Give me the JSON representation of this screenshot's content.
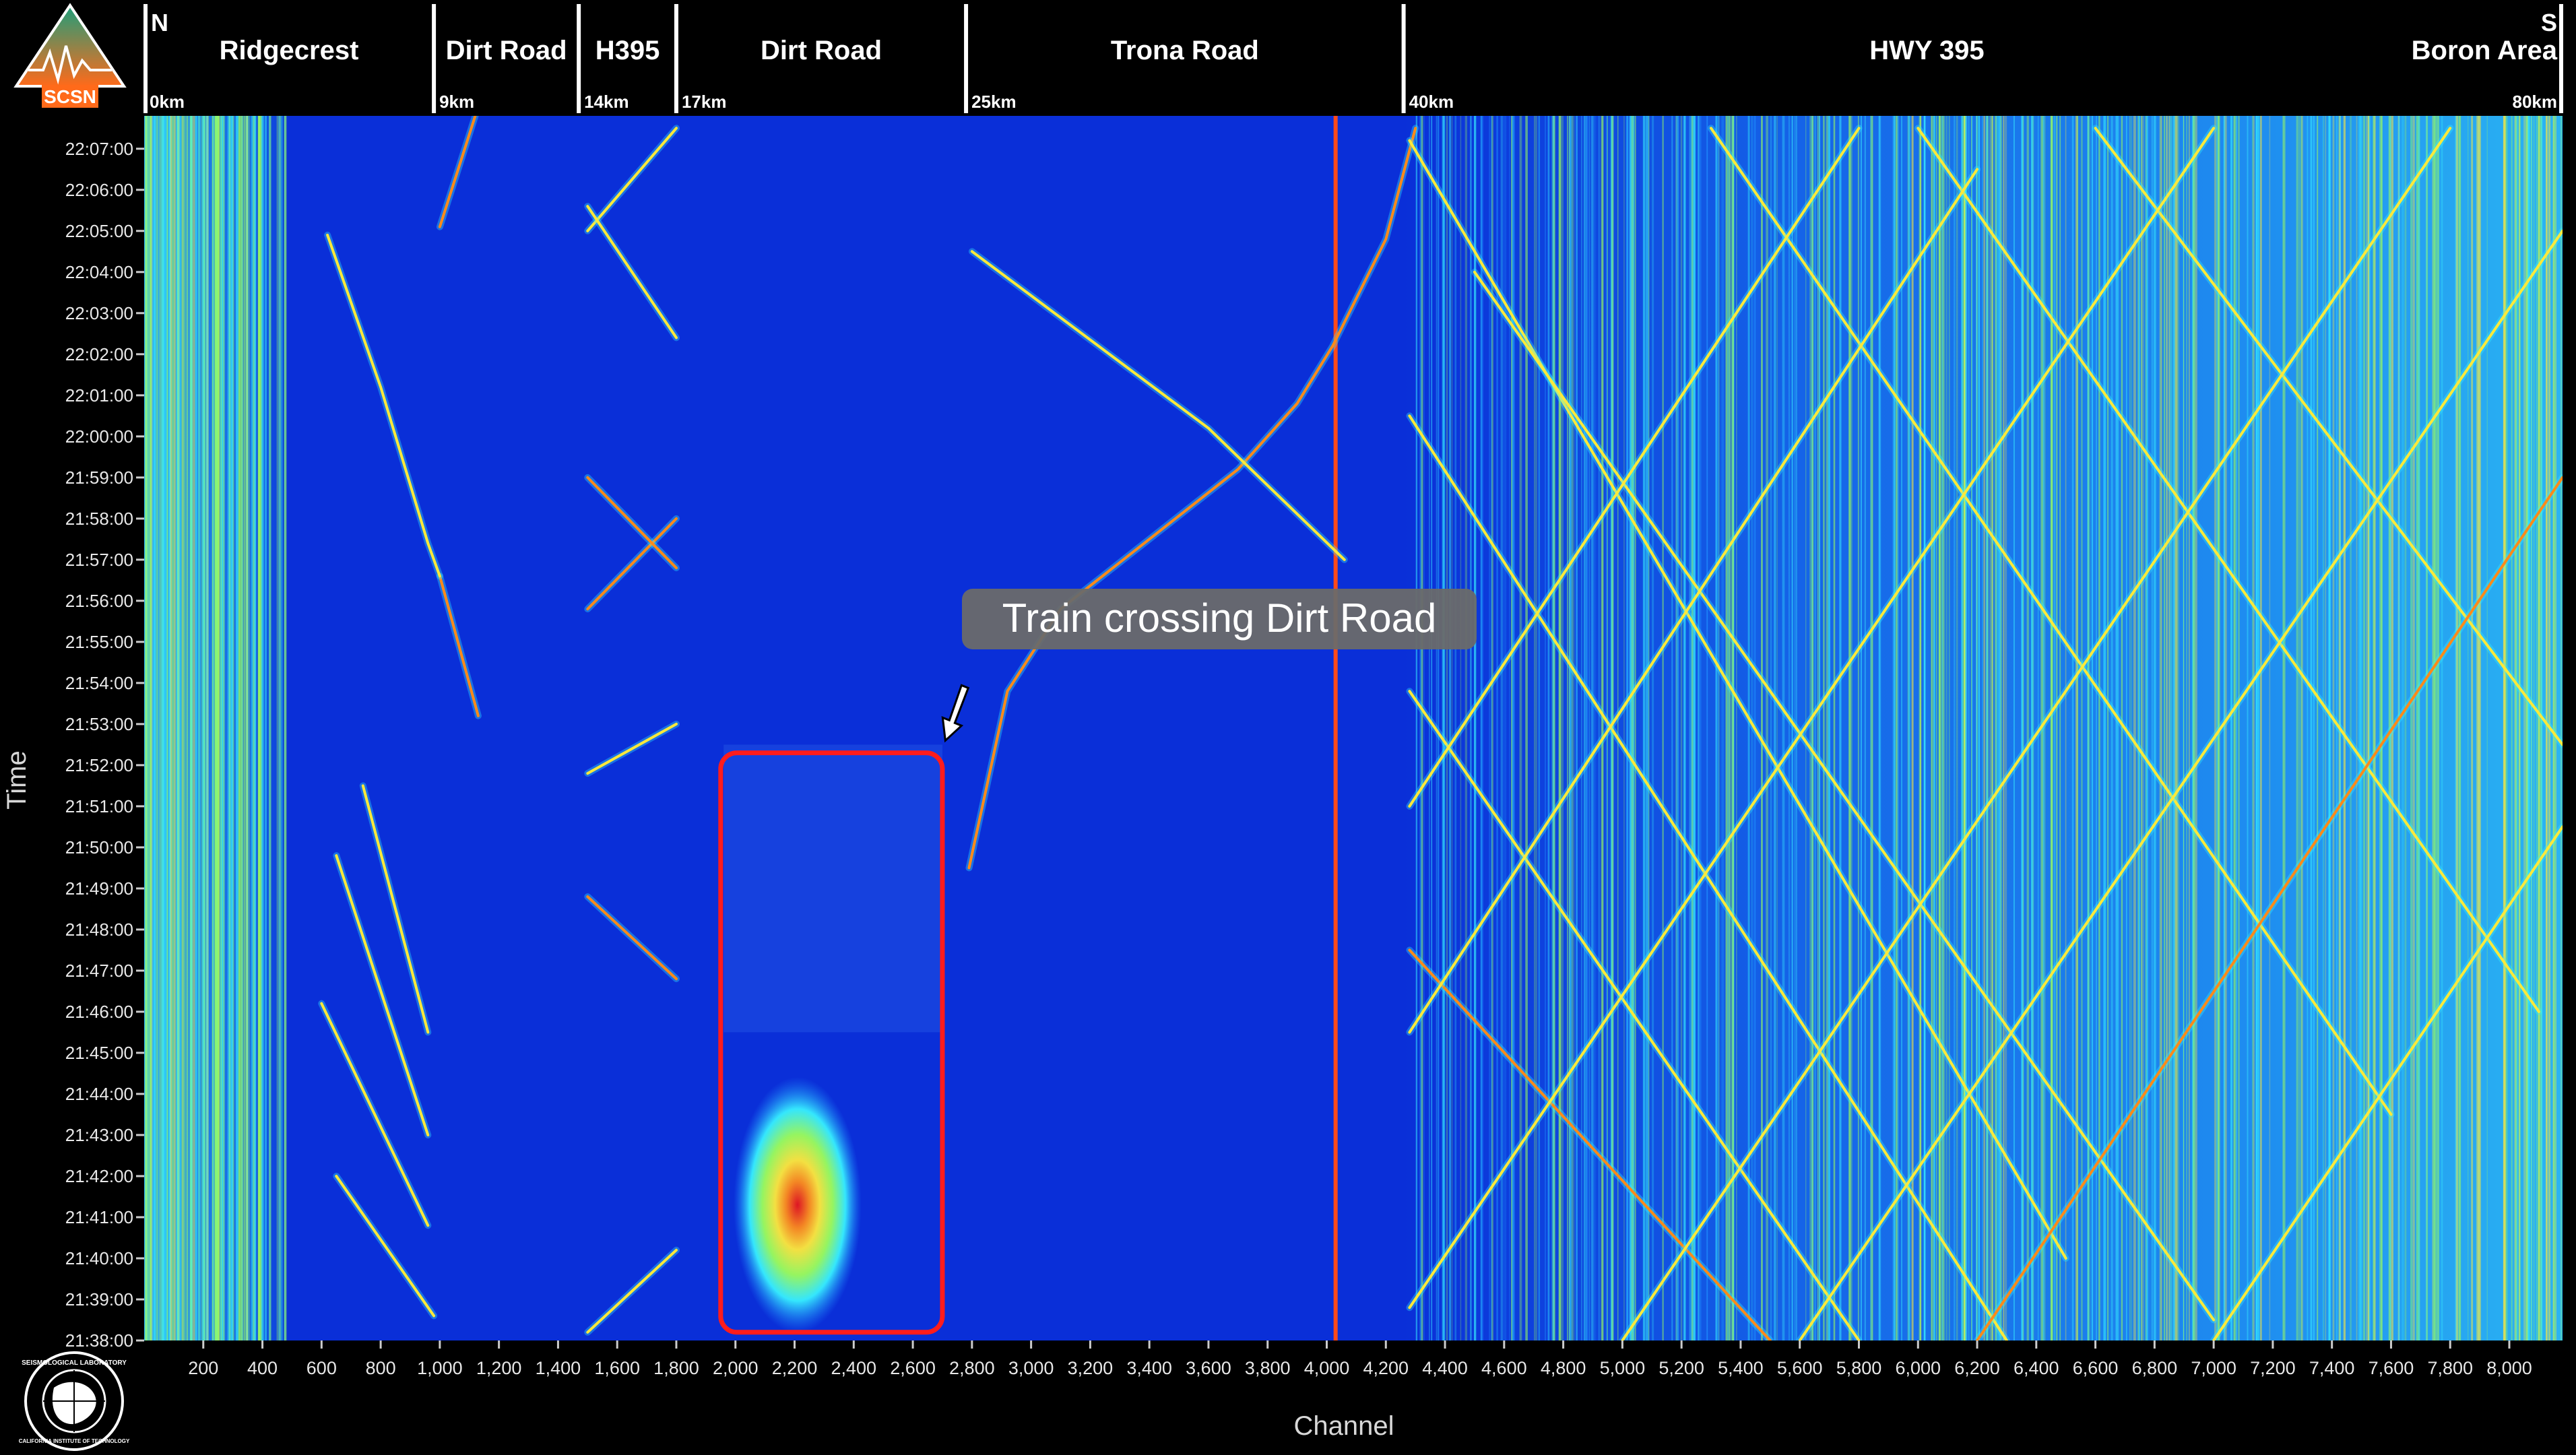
{
  "logos": {
    "scsn": "SCSN",
    "seismo_lab": "SEISMOLOGICAL LABORATORY",
    "caltech": "CALIFORNIA INSTITUTE OF TECHNOLOGY"
  },
  "header": {
    "north": "N",
    "south": "S",
    "segments": [
      {
        "label": "Ridgecrest",
        "start_channel": 0,
        "end_channel": 980
      },
      {
        "label": "Dirt Road",
        "start_channel": 980,
        "end_channel": 1470
      },
      {
        "label": "H395",
        "start_channel": 1470,
        "end_channel": 1800
      },
      {
        "label": "Dirt Road",
        "start_channel": 1800,
        "end_channel": 2780
      },
      {
        "label": "Trona Road",
        "start_channel": 2780,
        "end_channel": 4260
      },
      {
        "label": "HWY 395",
        "start_channel": 4260,
        "end_channel": 7800
      },
      {
        "label": "Boron Area",
        "start_channel": 7800,
        "end_channel": 8180
      }
    ],
    "divider_channels": [
      980,
      1470,
      1800,
      2780,
      4260
    ],
    "km_markers": [
      {
        "label": "0km",
        "channel": 0
      },
      {
        "label": "9km",
        "channel": 980
      },
      {
        "label": "14km",
        "channel": 1470
      },
      {
        "label": "17km",
        "channel": 1800
      },
      {
        "label": "25km",
        "channel": 2780
      },
      {
        "label": "40km",
        "channel": 4260
      },
      {
        "label": "80km",
        "channel": 8180
      }
    ]
  },
  "chart_data": {
    "type": "heatmap",
    "xlabel": "Channel",
    "ylabel": "Time",
    "xlim": [
      0,
      8180
    ],
    "ylim_minutes": [
      1298,
      1327.8
    ],
    "x_ticks": [
      {
        "v": 200,
        "label": "200"
      },
      {
        "v": 400,
        "label": "400"
      },
      {
        "v": 600,
        "label": "600"
      },
      {
        "v": 800,
        "label": "800"
      },
      {
        "v": 1000,
        "label": "1,000"
      },
      {
        "v": 1200,
        "label": "1,200"
      },
      {
        "v": 1400,
        "label": "1,400"
      },
      {
        "v": 1600,
        "label": "1,600"
      },
      {
        "v": 1800,
        "label": "1,800"
      },
      {
        "v": 2000,
        "label": "2,000"
      },
      {
        "v": 2200,
        "label": "2,200"
      },
      {
        "v": 2400,
        "label": "2,400"
      },
      {
        "v": 2600,
        "label": "2,600"
      },
      {
        "v": 2800,
        "label": "2,800"
      },
      {
        "v": 3000,
        "label": "3,000"
      },
      {
        "v": 3200,
        "label": "3,200"
      },
      {
        "v": 3400,
        "label": "3,400"
      },
      {
        "v": 3600,
        "label": "3,600"
      },
      {
        "v": 3800,
        "label": "3,800"
      },
      {
        "v": 4000,
        "label": "4,000"
      },
      {
        "v": 4200,
        "label": "4,200"
      },
      {
        "v": 4400,
        "label": "4,400"
      },
      {
        "v": 4600,
        "label": "4,600"
      },
      {
        "v": 4800,
        "label": "4,800"
      },
      {
        "v": 5000,
        "label": "5,000"
      },
      {
        "v": 5200,
        "label": "5,200"
      },
      {
        "v": 5400,
        "label": "5,400"
      },
      {
        "v": 5600,
        "label": "5,600"
      },
      {
        "v": 5800,
        "label": "5,800"
      },
      {
        "v": 6000,
        "label": "6,000"
      },
      {
        "v": 6200,
        "label": "6,200"
      },
      {
        "v": 6400,
        "label": "6,400"
      },
      {
        "v": 6600,
        "label": "6,600"
      },
      {
        "v": 6800,
        "label": "6,800"
      },
      {
        "v": 7000,
        "label": "7,000"
      },
      {
        "v": 7200,
        "label": "7,200"
      },
      {
        "v": 7400,
        "label": "7,400"
      },
      {
        "v": 7600,
        "label": "7,600"
      },
      {
        "v": 7800,
        "label": "7,800"
      },
      {
        "v": 8000,
        "label": "8,000"
      }
    ],
    "y_ticks": [
      {
        "minute": 1327,
        "label": "22:07:00"
      },
      {
        "minute": 1326,
        "label": "22:06:00"
      },
      {
        "minute": 1325,
        "label": "22:05:00"
      },
      {
        "minute": 1324,
        "label": "22:04:00"
      },
      {
        "minute": 1323,
        "label": "22:03:00"
      },
      {
        "minute": 1322,
        "label": "22:02:00"
      },
      {
        "minute": 1321,
        "label": "22:01:00"
      },
      {
        "minute": 1320,
        "label": "22:00:00"
      },
      {
        "minute": 1319,
        "label": "21:59:00"
      },
      {
        "minute": 1318,
        "label": "21:58:00"
      },
      {
        "minute": 1317,
        "label": "21:57:00"
      },
      {
        "minute": 1316,
        "label": "21:56:00"
      },
      {
        "minute": 1315,
        "label": "21:55:00"
      },
      {
        "minute": 1314,
        "label": "21:54:00"
      },
      {
        "minute": 1313,
        "label": "21:53:00"
      },
      {
        "minute": 1312,
        "label": "21:52:00"
      },
      {
        "minute": 1311,
        "label": "21:51:00"
      },
      {
        "minute": 1310,
        "label": "21:50:00"
      },
      {
        "minute": 1309,
        "label": "21:49:00"
      },
      {
        "minute": 1308,
        "label": "21:48:00"
      },
      {
        "minute": 1307,
        "label": "21:47:00"
      },
      {
        "minute": 1306,
        "label": "21:46:00"
      },
      {
        "minute": 1305,
        "label": "21:45:00"
      },
      {
        "minute": 1304,
        "label": "21:44:00"
      },
      {
        "minute": 1303,
        "label": "21:43:00"
      },
      {
        "minute": 1302,
        "label": "21:42:00"
      },
      {
        "minute": 1301,
        "label": "21:41:00"
      },
      {
        "minute": 1300,
        "label": "21:40:00"
      },
      {
        "minute": 1299,
        "label": "21:39:00"
      },
      {
        "minute": 1298,
        "label": "21:38:00"
      }
    ],
    "background_color": "#0a2fd8",
    "colormap": [
      "#0a2fd8",
      "#1e90ff",
      "#37f0ff",
      "#9dff5a",
      "#ffe93a",
      "#ff8a1a",
      "#e8141a"
    ],
    "highlight_box": {
      "x0": 1950,
      "x1": 2700,
      "t0": 1298.2,
      "t1": 1312.3,
      "color": "#ff1c1c"
    },
    "hot_spot": {
      "x": 2210,
      "t": 1301.3
    },
    "persistent_channel": {
      "x": 4030,
      "color": "#ff4a1a"
    },
    "annotation": {
      "text": "Train crossing Dirt Road",
      "arrow_to": {
        "x": 2710,
        "t": 1312.6
      }
    },
    "tracks": [
      {
        "segment": "Trona Road",
        "points": [
          [
            2790,
            1309.5
          ],
          [
            2920,
            1313.8
          ],
          [
            3100,
            1315.8
          ],
          [
            3400,
            1317.5
          ],
          [
            3700,
            1319.2
          ],
          [
            3900,
            1320.8
          ],
          [
            4020,
            1322.2
          ],
          [
            4200,
            1324.8
          ],
          [
            4300,
            1327.5
          ]
        ],
        "intensity": 0.9
      },
      {
        "segment": "Trona Road",
        "points": [
          [
            2800,
            1324.5
          ],
          [
            3600,
            1320.2
          ],
          [
            4060,
            1317.0
          ]
        ],
        "intensity": 0.55
      },
      {
        "segment": "Dirt Road",
        "points": [
          [
            1000,
            1325.1
          ],
          [
            1120,
            1327.8
          ]
        ],
        "intensity": 0.85
      },
      {
        "segment": "Dirt Road",
        "points": [
          [
            1000,
            1316.6
          ],
          [
            1130,
            1313.2
          ]
        ],
        "intensity": 0.85
      },
      {
        "segment": "Ridgecrest",
        "points": [
          [
            620,
            1324.9
          ],
          [
            800,
            1321.2
          ],
          [
            960,
            1317.4
          ],
          [
            1000,
            1316.6
          ]
        ],
        "intensity": 0.55
      },
      {
        "segment": "Ridgecrest",
        "points": [
          [
            650,
            1309.8
          ],
          [
            960,
            1303.0
          ]
        ],
        "intensity": 0.5
      },
      {
        "segment": "Ridgecrest",
        "points": [
          [
            650,
            1302.0
          ],
          [
            980,
            1298.6
          ]
        ],
        "intensity": 0.5
      },
      {
        "segment": "Ridgecrest",
        "points": [
          [
            600,
            1306.2
          ],
          [
            960,
            1300.8
          ]
        ],
        "intensity": 0.45
      },
      {
        "segment": "Ridgecrest",
        "points": [
          [
            740,
            1311.5
          ],
          [
            960,
            1305.5
          ]
        ],
        "intensity": 0.45
      },
      {
        "segment": "H395",
        "points": [
          [
            1500,
            1325.0
          ],
          [
            1800,
            1327.5
          ]
        ],
        "intensity": 0.7
      },
      {
        "segment": "H395",
        "points": [
          [
            1500,
            1325.6
          ],
          [
            1800,
            1322.4
          ]
        ],
        "intensity": 0.7
      },
      {
        "segment": "H395",
        "points": [
          [
            1500,
            1315.8
          ],
          [
            1800,
            1318.0
          ]
        ],
        "intensity": 0.75
      },
      {
        "segment": "H395",
        "points": [
          [
            1500,
            1319.0
          ],
          [
            1800,
            1316.8
          ]
        ],
        "intensity": 0.75
      },
      {
        "segment": "H395",
        "points": [
          [
            1500,
            1308.8
          ],
          [
            1800,
            1306.8
          ]
        ],
        "intensity": 0.75
      },
      {
        "segment": "H395",
        "points": [
          [
            1500,
            1311.8
          ],
          [
            1800,
            1313.0
          ]
        ],
        "intensity": 0.65
      },
      {
        "segment": "H395",
        "points": [
          [
            1500,
            1298.2
          ],
          [
            1800,
            1300.2
          ]
        ],
        "intensity": 0.6
      },
      {
        "segment": "HWY 395",
        "points": [
          [
            4280,
            1327.2
          ],
          [
            6500,
            1300.0
          ]
        ],
        "intensity": 0.6
      },
      {
        "segment": "HWY 395",
        "points": [
          [
            4500,
            1324.0
          ],
          [
            7000,
            1298.5
          ]
        ],
        "intensity": 0.7
      },
      {
        "segment": "HWY 395",
        "points": [
          [
            4280,
            1320.5
          ],
          [
            6300,
            1298.0
          ]
        ],
        "intensity": 0.55
      },
      {
        "segment": "HWY 395",
        "points": [
          [
            4280,
            1307.5
          ],
          [
            5500,
            1298.0
          ]
        ],
        "intensity": 0.8
      },
      {
        "segment": "HWY 395",
        "points": [
          [
            5300,
            1327.5
          ],
          [
            7600,
            1303.5
          ]
        ],
        "intensity": 0.6
      },
      {
        "segment": "HWY 395",
        "points": [
          [
            6000,
            1327.5
          ],
          [
            8100,
            1306.0
          ]
        ],
        "intensity": 0.65
      },
      {
        "segment": "HWY 395",
        "points": [
          [
            6600,
            1327.5
          ],
          [
            8180,
            1312.5
          ]
        ],
        "intensity": 0.55
      },
      {
        "segment": "HWY 395",
        "points": [
          [
            4280,
            1313.8
          ],
          [
            5800,
            1298.0
          ]
        ],
        "intensity": 0.6
      },
      {
        "segment": "HWY 395",
        "points": [
          [
            4280,
            1298.8
          ],
          [
            7000,
            1327.5
          ]
        ],
        "intensity": 0.6
      },
      {
        "segment": "HWY 395",
        "points": [
          [
            5000,
            1298.0
          ],
          [
            7800,
            1327.5
          ]
        ],
        "intensity": 0.7
      },
      {
        "segment": "HWY 395",
        "points": [
          [
            6200,
            1298.0
          ],
          [
            8180,
            1319.0
          ]
        ],
        "intensity": 0.75
      },
      {
        "segment": "HWY 395",
        "points": [
          [
            4280,
            1305.5
          ],
          [
            6200,
            1326.5
          ]
        ],
        "intensity": 0.55
      },
      {
        "segment": "HWY 395",
        "points": [
          [
            7000,
            1298.0
          ],
          [
            8180,
            1310.5
          ]
        ],
        "intensity": 0.65
      },
      {
        "segment": "HWY 395",
        "points": [
          [
            4280,
            1311.0
          ],
          [
            5800,
            1327.5
          ]
        ],
        "intensity": 0.5
      },
      {
        "segment": "HWY 395",
        "points": [
          [
            5600,
            1298.0
          ],
          [
            8180,
            1325.0
          ]
        ],
        "intensity": 0.6
      }
    ]
  }
}
